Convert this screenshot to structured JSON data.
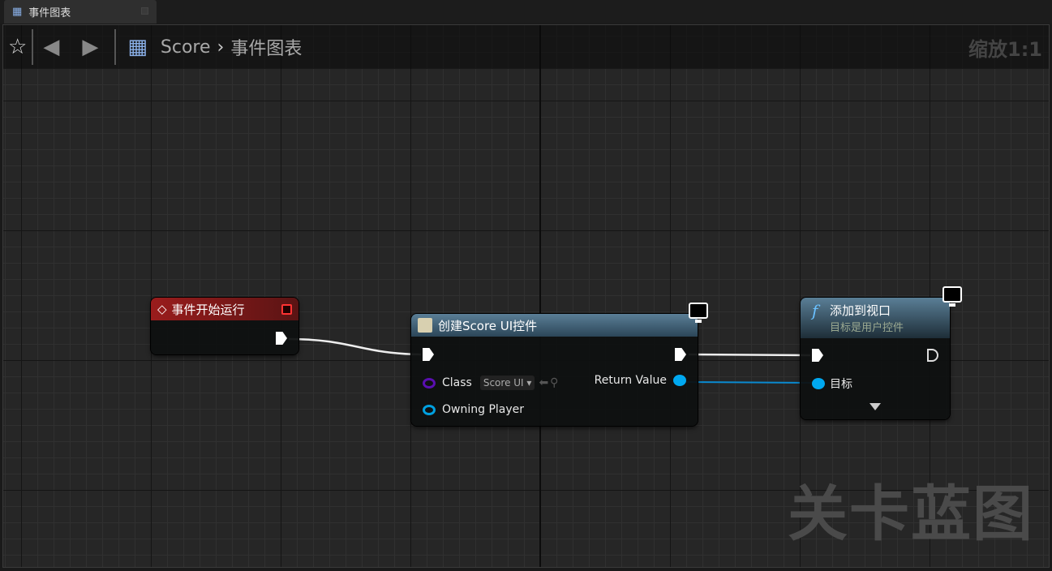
{
  "tab": {
    "label": "事件图表",
    "icon": "graph-icon"
  },
  "toolbar": {
    "breadcrumb": [
      "Score",
      "事件图表"
    ],
    "zoom": "缩放1:1"
  },
  "watermark": "关卡蓝图",
  "nodes": {
    "begin_play": {
      "title": "事件开始运行",
      "color": "#8a1a1a"
    },
    "create_widget": {
      "title": "创建Score UI控件",
      "class_label": "Class",
      "class_value": "Score UI",
      "owning_player": "Owning Player",
      "return_value": "Return Value",
      "color": "#3d5f78"
    },
    "add_to_viewport": {
      "title": "添加到视口",
      "subtitle": "目标是用户控件",
      "target_label": "目标",
      "color": "#3d5f78"
    }
  },
  "colors": {
    "exec": "#ffffff",
    "object_pin": "#00a8f0",
    "class_pin": "#5a0fb0"
  }
}
